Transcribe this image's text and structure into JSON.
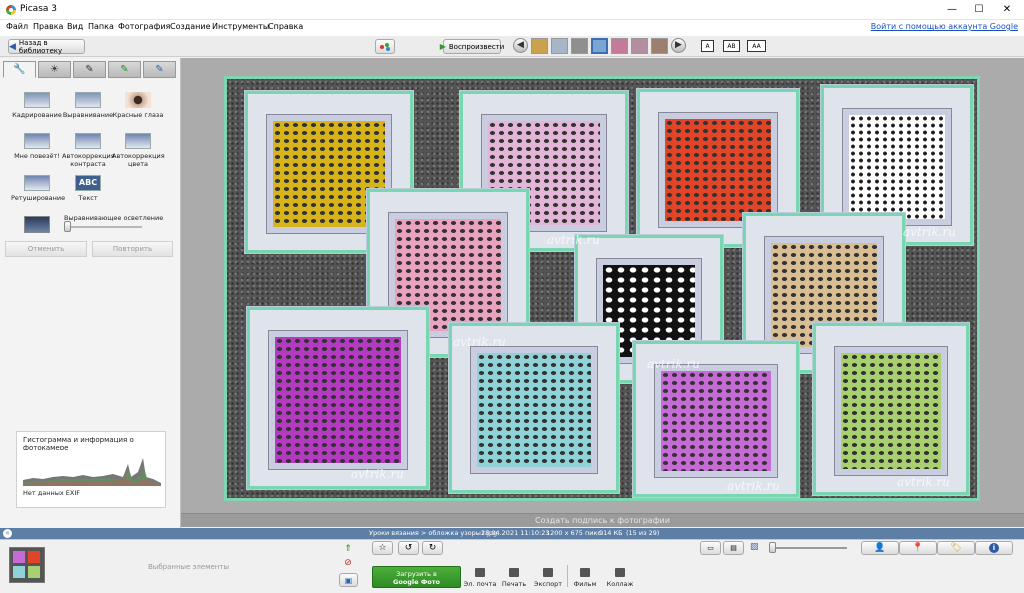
{
  "window": {
    "title": "Picasa 3",
    "minimize": "—",
    "maximize": "☐",
    "close": "✕"
  },
  "menu": {
    "items": [
      "Файл",
      "Правка",
      "Вид",
      "Папка",
      "Фотография",
      "Создание",
      "Инструменты",
      "Справка"
    ],
    "signin": "Войти с помощью аккаунта Google"
  },
  "toolbar": {
    "back_label": "Назад в библиотеку",
    "play_label": "Воспроизвести",
    "size_labels": [
      "A",
      "AB",
      "AA"
    ]
  },
  "edit_panel": {
    "tabs": [
      "wrench-icon",
      "sun-icon",
      "brush-icon",
      "brush-green-icon",
      "brush-blue-icon"
    ],
    "tools": [
      {
        "label": "Кадрирование",
        "icon": "crop-icon"
      },
      {
        "label": "Выравнивание",
        "icon": "straighten-icon"
      },
      {
        "label": "Красные глаза",
        "icon": "redeye-icon"
      },
      {
        "label": "Мне повезёт!",
        "icon": "lucky-icon"
      },
      {
        "label": "Автокоррекция контраста",
        "icon": "autocontrast-icon"
      },
      {
        "label": "Автокоррекция цвета",
        "icon": "autocolor-icon"
      },
      {
        "label": "Ретуширование",
        "icon": "retouch-icon"
      },
      {
        "label": "Текст",
        "icon": "text-icon",
        "glyph": "ABC"
      }
    ],
    "fill_light_label": "Выравнивающее осветление",
    "fill_light_value": 0,
    "undo_label": "Отменить",
    "redo_label": "Повторить",
    "histogram": {
      "title": "Гистограмма и информация о фотокамере",
      "exif": "Нет данных EXIF"
    }
  },
  "photo": {
    "watermark": "avtrik.ru",
    "swatches": [
      "#d7b41c",
      "#e3b6d8",
      "#e24428",
      "#ffffff",
      "#e9a2bf",
      "#111111",
      "#d9bd93",
      "#b43ac2",
      "#8fd2d8",
      "#c66ad5",
      "#a8d070"
    ]
  },
  "caption": {
    "placeholder": "Создать подпись к фотографии"
  },
  "status": {
    "path": "Уроки вязания > обложка узоры1.jpg",
    "date": "28.04.2021 11:10:23",
    "dimensions": "1200 x 675 пикс.",
    "filesize": "914 КБ",
    "position": "(15 из 29)"
  },
  "bottom": {
    "selected_label": "Выбранные элементы",
    "upload_label_1": "Загрузить в",
    "upload_label_2": "Google Фото",
    "actions": [
      "Эл. почта",
      "Печать",
      "Экспорт",
      "Фильм",
      "Коллаж"
    ]
  }
}
